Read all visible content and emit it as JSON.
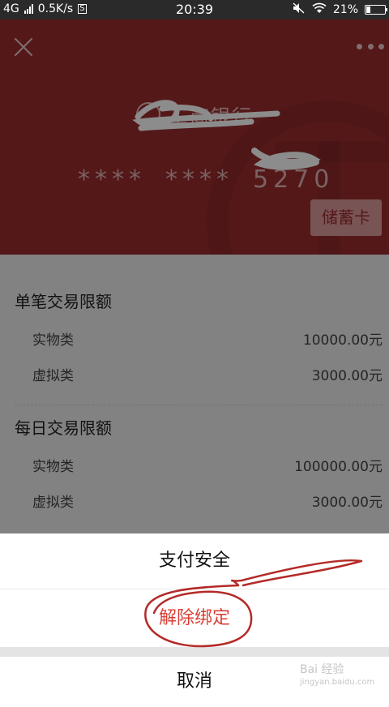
{
  "status_bar": {
    "network": "4G",
    "speed": "0.5K/s",
    "s_badge": "S",
    "time": "20:39",
    "battery": "21%"
  },
  "card": {
    "bank_name": "工商银行",
    "number_groups": [
      "****",
      "****",
      "5270"
    ],
    "card_type": "储蓄卡",
    "background_color": "#9a2c2f"
  },
  "limits": {
    "single": {
      "title": "单笔交易限额",
      "rows": [
        {
          "label": "实物类",
          "value": "10000.00元"
        },
        {
          "label": "虚拟类",
          "value": "3000.00元"
        }
      ]
    },
    "daily": {
      "title": "每日交易限额",
      "rows": [
        {
          "label": "实物类",
          "value": "100000.00元"
        },
        {
          "label": "虚拟类",
          "value": "3000.00元"
        }
      ]
    }
  },
  "action_sheet": {
    "payment_security": "支付安全",
    "unbind": "解除绑定",
    "cancel": "取消",
    "danger_color": "#d84036"
  },
  "watermark": {
    "line1": "Bai 经验",
    "line2": "jingyan.baidu.com"
  }
}
